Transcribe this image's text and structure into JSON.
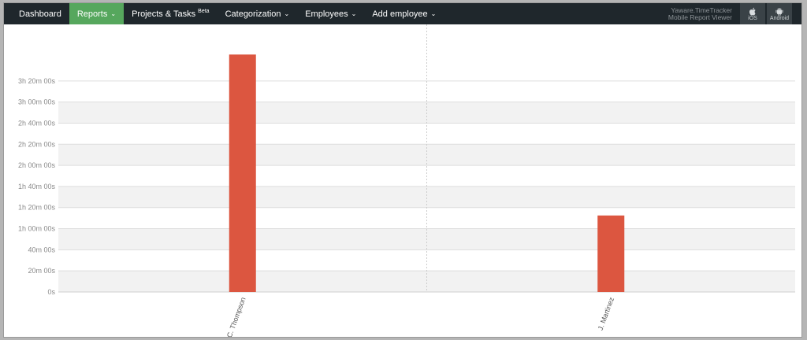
{
  "navbar": {
    "items": [
      {
        "label": "Dashboard",
        "dropdown": false,
        "active": false
      },
      {
        "label": "Reports",
        "dropdown": true,
        "active": true
      },
      {
        "label": "Projects & Tasks",
        "badge": "Beta",
        "dropdown": false,
        "active": false
      },
      {
        "label": "Categorization",
        "dropdown": true,
        "active": false
      },
      {
        "label": "Employees",
        "dropdown": true,
        "active": false
      },
      {
        "label": "Add employee",
        "dropdown": true,
        "active": false
      }
    ],
    "brand_line1": "Yaware.TimeTracker",
    "brand_line2": "Mobile Report Viewer",
    "ios_label": "iOS",
    "android_label": "Android",
    "caret_glyph": "⌄",
    "apple_icon": "apple-icon",
    "android_icon": "android-icon"
  },
  "colors": {
    "navbar_bg": "#1f272c",
    "active_tab": "#56a75d",
    "bar": "#dc5640",
    "band": "#f2f2f2"
  },
  "chart_data": {
    "type": "bar",
    "categories": [
      "C. Thompson",
      "J. Martinez"
    ],
    "values_seconds": [
      13500,
      4350
    ],
    "ylim_seconds": [
      0,
      13200
    ],
    "y_ticks": [
      {
        "value": 0,
        "label": "0s"
      },
      {
        "value": 1200,
        "label": "20m 00s"
      },
      {
        "value": 2400,
        "label": "40m 00s"
      },
      {
        "value": 3600,
        "label": "1h 00m 00s"
      },
      {
        "value": 4800,
        "label": "1h 20m 00s"
      },
      {
        "value": 6000,
        "label": "1h 40m 00s"
      },
      {
        "value": 7200,
        "label": "2h 00m 00s"
      },
      {
        "value": 8400,
        "label": "2h 20m 00s"
      },
      {
        "value": 9600,
        "label": "2h 40m 00s"
      },
      {
        "value": 10800,
        "label": "3h 00m 00s"
      },
      {
        "value": 12000,
        "label": "3h 20m 00s"
      }
    ],
    "grid": true,
    "legend": false
  }
}
